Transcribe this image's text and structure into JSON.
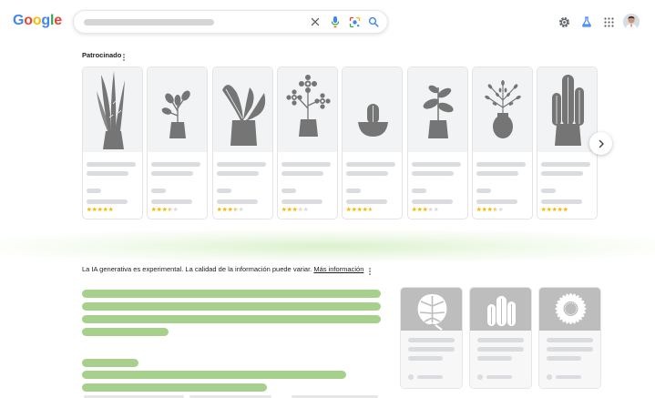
{
  "header": {
    "logo_text": "Google",
    "logo_colors": [
      "#4285F4",
      "#EA4335",
      "#FBBC05",
      "#4285F4",
      "#34A853",
      "#EA4335"
    ],
    "search_icons": [
      "close-icon",
      "mic-icon",
      "lens-icon",
      "search-icon"
    ],
    "right_icons": [
      "gear-icon",
      "labs-flask-icon",
      "apps-grid-icon",
      "account-avatar"
    ]
  },
  "sponsored": {
    "label": "Patrocinado",
    "products": [
      {
        "plant": "snake-plant",
        "rating": 5
      },
      {
        "plant": "small-leafy-plant",
        "rating": 3.5
      },
      {
        "plant": "large-leaf-plant",
        "rating": 3.5
      },
      {
        "plant": "flowering-plant",
        "rating": 3
      },
      {
        "plant": "cactus-bowl",
        "rating": 4.5
      },
      {
        "plant": "rubber-plant",
        "rating": 3
      },
      {
        "plant": "fern-plant",
        "rating": 3.5
      },
      {
        "plant": "tall-cactus",
        "rating": 5
      }
    ],
    "next_icon": "chevron-right-icon"
  },
  "ai": {
    "notice": "La IA generativa es experimental. La calidad de la información puede variar.",
    "link": "Más información",
    "cards": [
      {
        "thumb": "monstera-leaf"
      },
      {
        "thumb": "cactus"
      },
      {
        "thumb": "sunflower"
      }
    ]
  },
  "colors": {
    "star": "#FBBC04",
    "star_empty": "#DADCE0",
    "ai_bar": "#A8D08D",
    "skeleton": "#DADCE0",
    "plant": "#757575"
  }
}
